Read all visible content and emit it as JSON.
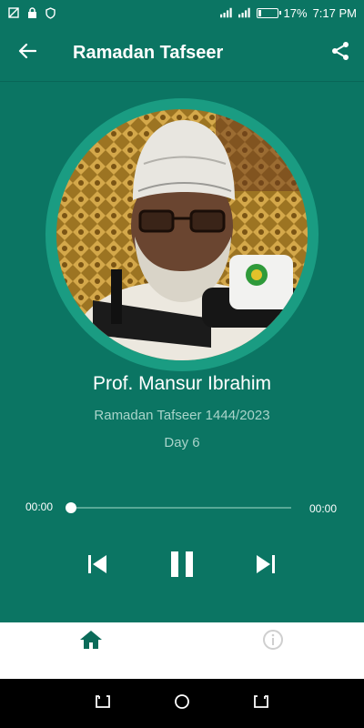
{
  "status_bar": {
    "battery_percent": "17%",
    "battery_level": 0.17,
    "time": "7:17 PM",
    "icons": [
      "screenshot-icon",
      "lock-icon",
      "shield-icon",
      "signal-icon",
      "signal-icon",
      "battery-icon"
    ]
  },
  "app_bar": {
    "title": "Ramadan Tafseer",
    "back_icon": "arrow-back-icon",
    "share_icon": "share-icon"
  },
  "player": {
    "artwork_alt": "speaker-portrait",
    "title": "Prof. Mansur Ibrahim",
    "subtitle": "Ramadan Tafseer 1444/2023",
    "episode": "Day 6",
    "current_time": "00:00",
    "total_time": "00:00",
    "progress": 0,
    "controls": [
      "skip-previous-icon",
      "pause-icon",
      "skip-next-icon"
    ]
  },
  "bottom_nav": {
    "items": [
      {
        "icon": "home-icon",
        "active": true
      },
      {
        "icon": "info-icon",
        "active": false
      }
    ]
  },
  "colors": {
    "primary": "#0b7563",
    "ring": "#1a9c82",
    "muted_text": "#a9d4ca",
    "nav_active": "#0b6b59",
    "nav_inactive": "#cfcfcf"
  }
}
